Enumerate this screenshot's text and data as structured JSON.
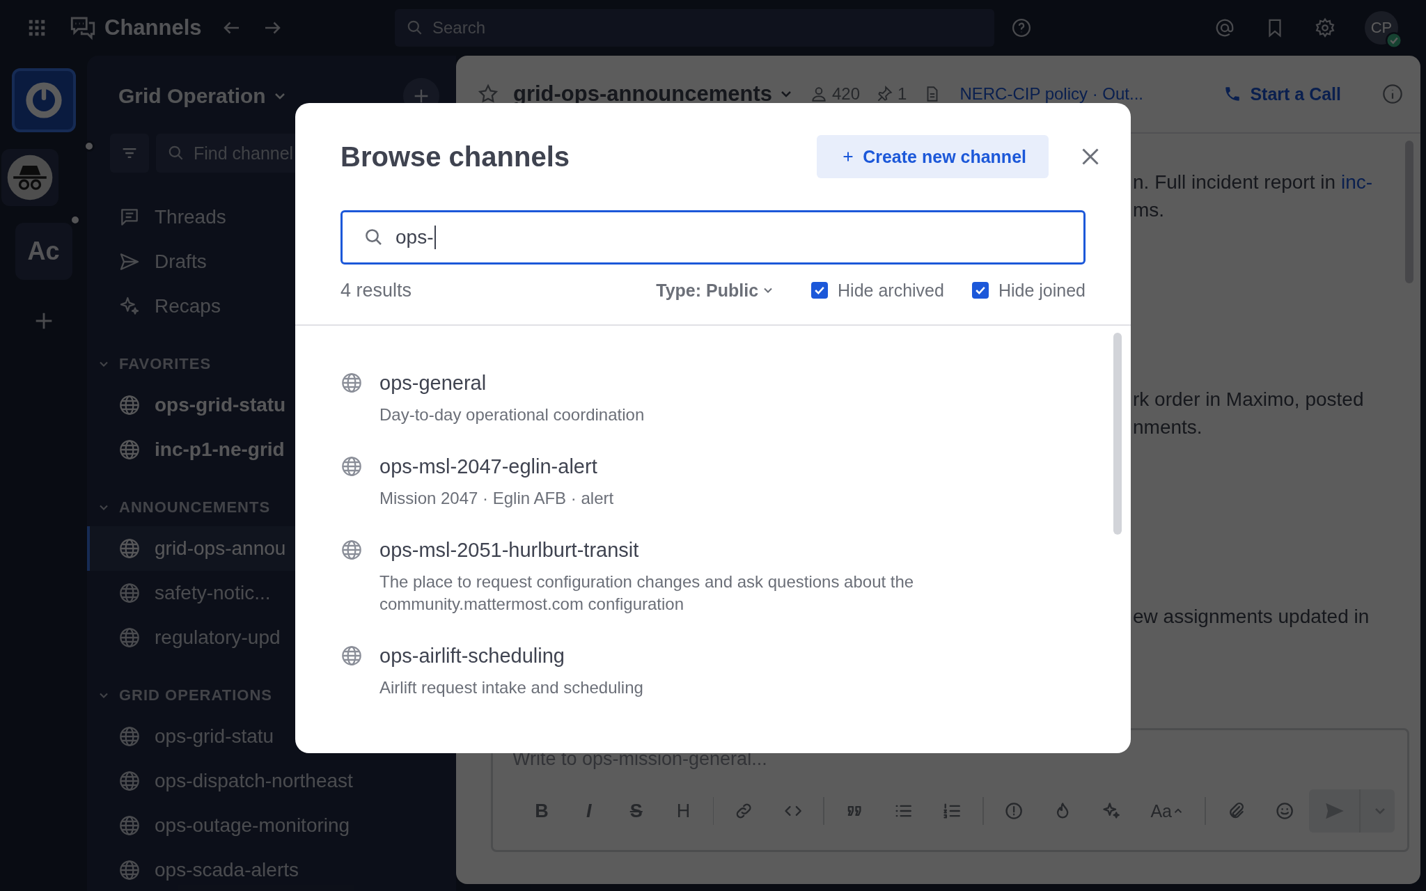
{
  "top_bar": {
    "product": "Channels",
    "search": {
      "placeholder": "Search"
    },
    "avatar": {
      "initials": "CP",
      "online": true
    }
  },
  "teams": [
    {
      "kind": "logo",
      "selected": true,
      "unread": false
    },
    {
      "kind": "avatar",
      "selected": false,
      "unread": true
    },
    {
      "kind": "initials",
      "label": "Ac",
      "selected": false,
      "unread": true
    }
  ],
  "sidebar": {
    "team_name": "Grid Operation",
    "find": {
      "placeholder": "Find channel"
    },
    "nav": [
      {
        "kind": "threads",
        "label": "Threads"
      },
      {
        "kind": "drafts",
        "label": "Drafts"
      },
      {
        "kind": "recaps",
        "label": "Recaps"
      }
    ],
    "sections": [
      {
        "title": "FAVORITES",
        "expanded": true,
        "channels": [
          {
            "name": "ops-grid-statu",
            "unread": true,
            "selected": false
          },
          {
            "name": "inc-p1-ne-grid",
            "unread": true,
            "selected": false
          }
        ]
      },
      {
        "title": "ANNOUNCEMENTS",
        "expanded": true,
        "channels": [
          {
            "name": "grid-ops-annou",
            "unread": false,
            "selected": true
          },
          {
            "name": "safety-notic...",
            "unread": false,
            "selected": false
          },
          {
            "name": "regulatory-upd",
            "unread": false,
            "selected": false
          }
        ]
      },
      {
        "title": "GRID OPERATIONS",
        "expanded": true,
        "channels": [
          {
            "name": "ops-grid-statu",
            "unread": false,
            "selected": false
          },
          {
            "name": "ops-dispatch-northeast",
            "unread": false,
            "selected": false
          },
          {
            "name": "ops-outage-monitoring",
            "unread": false,
            "selected": false
          },
          {
            "name": "ops-scada-alerts",
            "unread": false,
            "selected": false
          }
        ]
      }
    ]
  },
  "channel_header": {
    "name": "grid-ops-announcements",
    "favorite": false,
    "members": "420",
    "pinned": "1",
    "files_link": "NERC-CIP policy · Out...",
    "call": "Start a Call"
  },
  "posts": [
    {
      "lines": [
        {
          "text": "n. Full incident report in",
          "link": "inc-"
        },
        {
          "text": "ms."
        }
      ]
    },
    {
      "lines": [
        {
          "text": "rk order in Maximo, posted"
        },
        {
          "text": "nments."
        }
      ]
    },
    {
      "lines": [
        {
          "text": "ew assignments updated in"
        }
      ]
    }
  ],
  "composer": {
    "placeholder": "Write to ops-mission-general...",
    "send_disabled": true,
    "tool_groups": [
      [
        {
          "kind": "bold",
          "glyph": "B"
        },
        {
          "kind": "italic",
          "glyph": "I"
        },
        {
          "kind": "strike",
          "glyph": "S"
        },
        {
          "kind": "heading",
          "glyph": "H"
        }
      ],
      [
        {
          "kind": "link"
        },
        {
          "kind": "code"
        }
      ],
      [
        {
          "kind": "quote"
        },
        {
          "kind": "bullets"
        },
        {
          "kind": "numbered"
        }
      ],
      [
        {
          "kind": "priority"
        },
        {
          "kind": "burn"
        },
        {
          "kind": "ai"
        },
        {
          "kind": "format",
          "glyph": "Aa"
        }
      ],
      [
        {
          "kind": "attach"
        },
        {
          "kind": "emoji"
        }
      ]
    ]
  },
  "modal": {
    "title": "Browse channels",
    "create_button": "Create new channel",
    "search": {
      "value": "ops-",
      "focused": true
    },
    "result_count": "4 results",
    "type_filter": "Type: Public",
    "filters": [
      {
        "label": "Hide archived",
        "checked": true
      },
      {
        "label": "Hide joined",
        "checked": true
      }
    ],
    "channels": [
      {
        "name": "ops-general",
        "description": "Day-to-day operational coordination"
      },
      {
        "name": "ops-msl-2047-eglin-alert",
        "description": "Mission 2047 · Eglin AFB · alert"
      },
      {
        "name": "ops-msl-2051-hurlburt-transit",
        "description": "The place to request configuration changes and ask questions about the community.mattermost.com configuration"
      },
      {
        "name": "ops-airlift-scheduling",
        "description": "Airlift request intake and scheduling"
      }
    ]
  }
}
